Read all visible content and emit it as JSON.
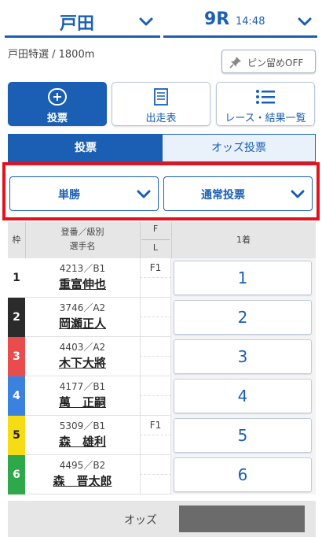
{
  "header": {
    "venue": "戸田",
    "race_number": "9R",
    "race_time": "14:48"
  },
  "race": {
    "info": "戸田特選 / 1800m",
    "pin_label": "ピン留めOFF"
  },
  "nav": {
    "vote_label": "投票",
    "entry_label": "出走表",
    "result_label": "レース・結果一覧"
  },
  "tabs": {
    "vote": "投票",
    "odds_vote": "オッズ投票"
  },
  "dropdowns": {
    "bet_type": "単勝",
    "vote_method": "通常投票"
  },
  "table": {
    "headers": {
      "frame": "枠",
      "reg_line1": "登番／級別",
      "reg_line2": "選手名",
      "f": "F",
      "l": "L",
      "first": "1着"
    },
    "rows": [
      {
        "frame": "1",
        "reg": "4213／B1",
        "name": "重富伸也",
        "f": "F1",
        "pick": "1",
        "color": "#ffffff",
        "text_color": "#222222"
      },
      {
        "frame": "2",
        "reg": "3746／A2",
        "name": "岡瀬正人",
        "f": "",
        "pick": "2",
        "color": "#2b2b2b",
        "text_color": "#ffffff"
      },
      {
        "frame": "3",
        "reg": "4403／A2",
        "name": "木下大將",
        "f": "",
        "pick": "3",
        "color": "#e84c4c",
        "text_color": "#ffffff"
      },
      {
        "frame": "4",
        "reg": "4177／B1",
        "name": "萬　正嗣",
        "f": "",
        "pick": "4",
        "color": "#3b82e0",
        "text_color": "#ffffff"
      },
      {
        "frame": "5",
        "reg": "5309／B1",
        "name": "森　雄利",
        "f": "F1",
        "pick": "5",
        "color": "#f5dc14",
        "text_color": "#222222"
      },
      {
        "frame": "6",
        "reg": "4495／B2",
        "name": "森　晋太郎",
        "f": "",
        "pick": "6",
        "color": "#2fa84a",
        "text_color": "#ffffff"
      }
    ]
  },
  "odds": {
    "label": "オッズ"
  },
  "colors": {
    "accent": "#1a5fb4",
    "highlight_frame": "#e3121e"
  }
}
